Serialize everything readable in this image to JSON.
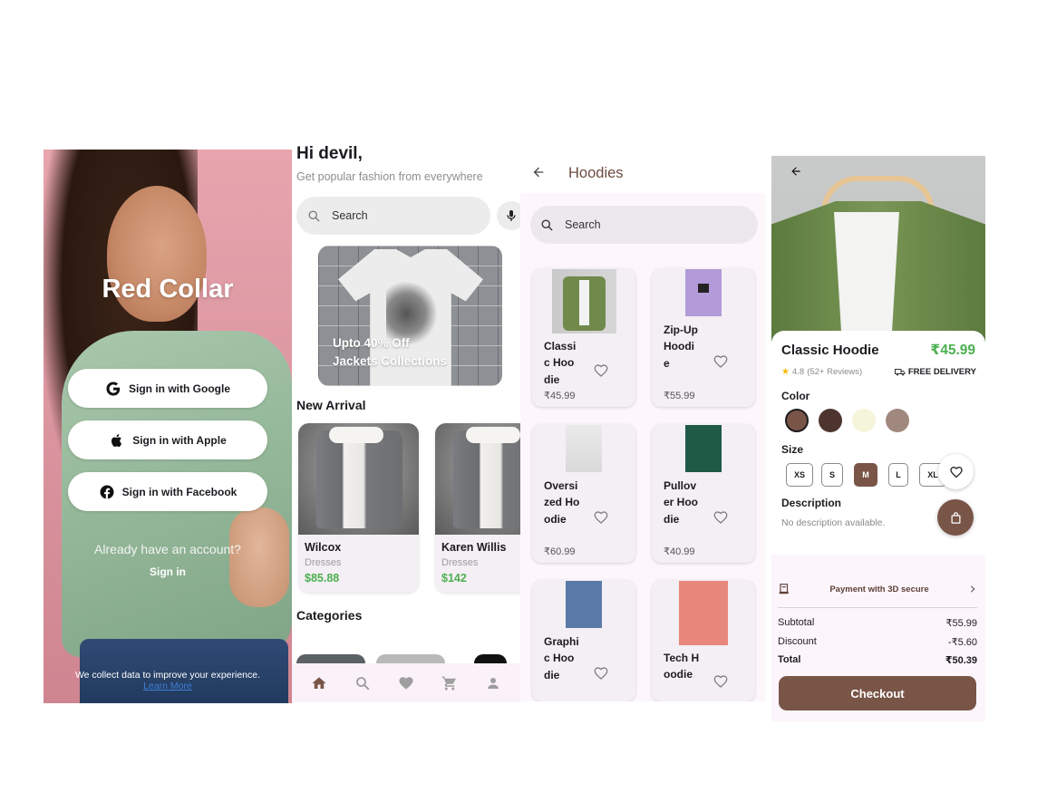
{
  "signin": {
    "app_name": "Red Collar",
    "buttons": [
      {
        "label": "Sign in with Google",
        "icon": "google-icon"
      },
      {
        "label": "Sign in with Apple",
        "icon": "apple-icon"
      },
      {
        "label": "Sign in with Facebook",
        "icon": "facebook-icon"
      }
    ],
    "already_text": "Already have an account?",
    "signin_link": "Sign in",
    "privacy_text": "We collect data to improve your experience.",
    "learn_more": "Learn More"
  },
  "home": {
    "greeting": "Hi devil,",
    "subtitle": "Get popular fashion from everywhere",
    "search_placeholder": "Search",
    "banner": {
      "line1": "Upto 40% Off",
      "line2": "Jackets Collections"
    },
    "new_arrival_title": "New Arrival",
    "new_arrivals": [
      {
        "name": "Wilcox",
        "category": "Dresses",
        "price": "$85.88"
      },
      {
        "name": "Karen Willis",
        "category": "Dresses",
        "price": "$142"
      }
    ],
    "categories_title": "Categories",
    "bottom_nav": [
      "home",
      "search",
      "favorites",
      "cart",
      "profile"
    ],
    "active_nav": "home"
  },
  "hoodies": {
    "title": "Hoodies",
    "search_placeholder": "Search",
    "items": [
      {
        "name": "Classic Hoodie",
        "price": "₹45.99"
      },
      {
        "name": "Zip-Up Hoodie",
        "price": "₹55.99"
      },
      {
        "name": "Oversized Hoodie",
        "price": "₹60.99"
      },
      {
        "name": "Pullover Hoodie",
        "price": "₹40.99"
      },
      {
        "name": "Graphic Hoodie",
        "price": ""
      },
      {
        "name": "Tech Hoodie",
        "price": ""
      }
    ]
  },
  "product": {
    "name": "Classic Hoodie",
    "price": "₹45.99",
    "rating": "4.8",
    "reviews": "(52+ Reviews)",
    "delivery": "FREE DELIVERY",
    "color_label": "Color",
    "colors": [
      "#795548",
      "#4e342e",
      "#f5f5dc",
      "#a1887f"
    ],
    "selected_color": 0,
    "size_label": "Size",
    "sizes": [
      "XS",
      "S",
      "M",
      "L",
      "XL"
    ],
    "selected_size": "M",
    "description_label": "Description",
    "description": "No description available.",
    "payment_text": "Payment with 3D secure",
    "summary": [
      {
        "label": "Subtotal",
        "value": "₹55.99"
      },
      {
        "label": "Discount",
        "value": "-₹5.60"
      },
      {
        "label": "Total",
        "value": "₹50.39"
      }
    ],
    "checkout_label": "Checkout",
    "accent": "#795548",
    "price_color": "#4caf50"
  }
}
